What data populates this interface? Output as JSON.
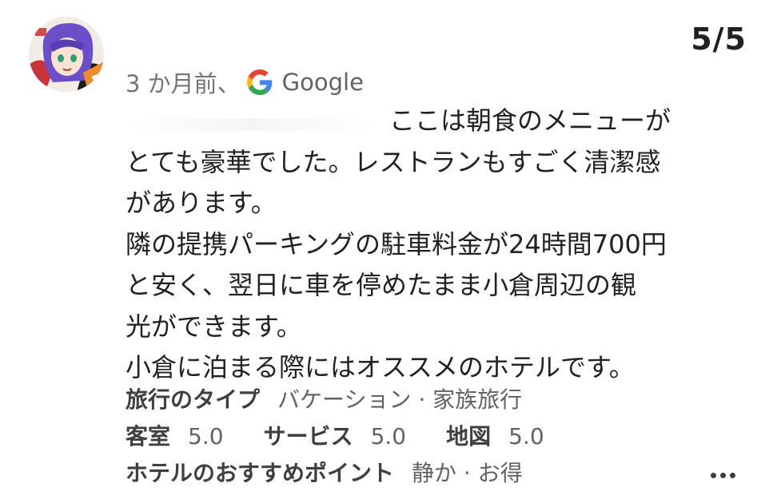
{
  "review": {
    "page_counter": "5/5",
    "time_ago": "3 か月前、",
    "source": "Google",
    "body_lines": [
      "ここは朝食のメニューが",
      "とても豪華でした。レストランもすごく清潔感",
      "があります。",
      "隣の提携パーキングの駐車料金が24時間700円",
      "と安く、翌日に車を停めたまま小倉周辺の観",
      "光ができます。",
      "小倉に泊まる際にはオススメのホテルです。"
    ]
  },
  "details": {
    "trip_type_label": "旅行のタイプ",
    "trip_type_value": "バケーション · 家族旅行",
    "room_label": "客室",
    "room_value": "5.0",
    "service_label": "サービス",
    "service_value": "5.0",
    "location_label": "地図",
    "location_value": "5.0",
    "highlights_label": "ホテルのおすすめポイント",
    "highlights_value": "静か · お得"
  },
  "icons": {
    "avatar": "user-avatar-anime-character",
    "source": "google-g-icon",
    "more": "more-options-icon"
  },
  "colors": {
    "text": "#202124",
    "secondary": "#70757a",
    "google_blue": "#4285F4",
    "google_red": "#EA4335",
    "google_yellow": "#FBBC05",
    "google_green": "#34A853"
  }
}
